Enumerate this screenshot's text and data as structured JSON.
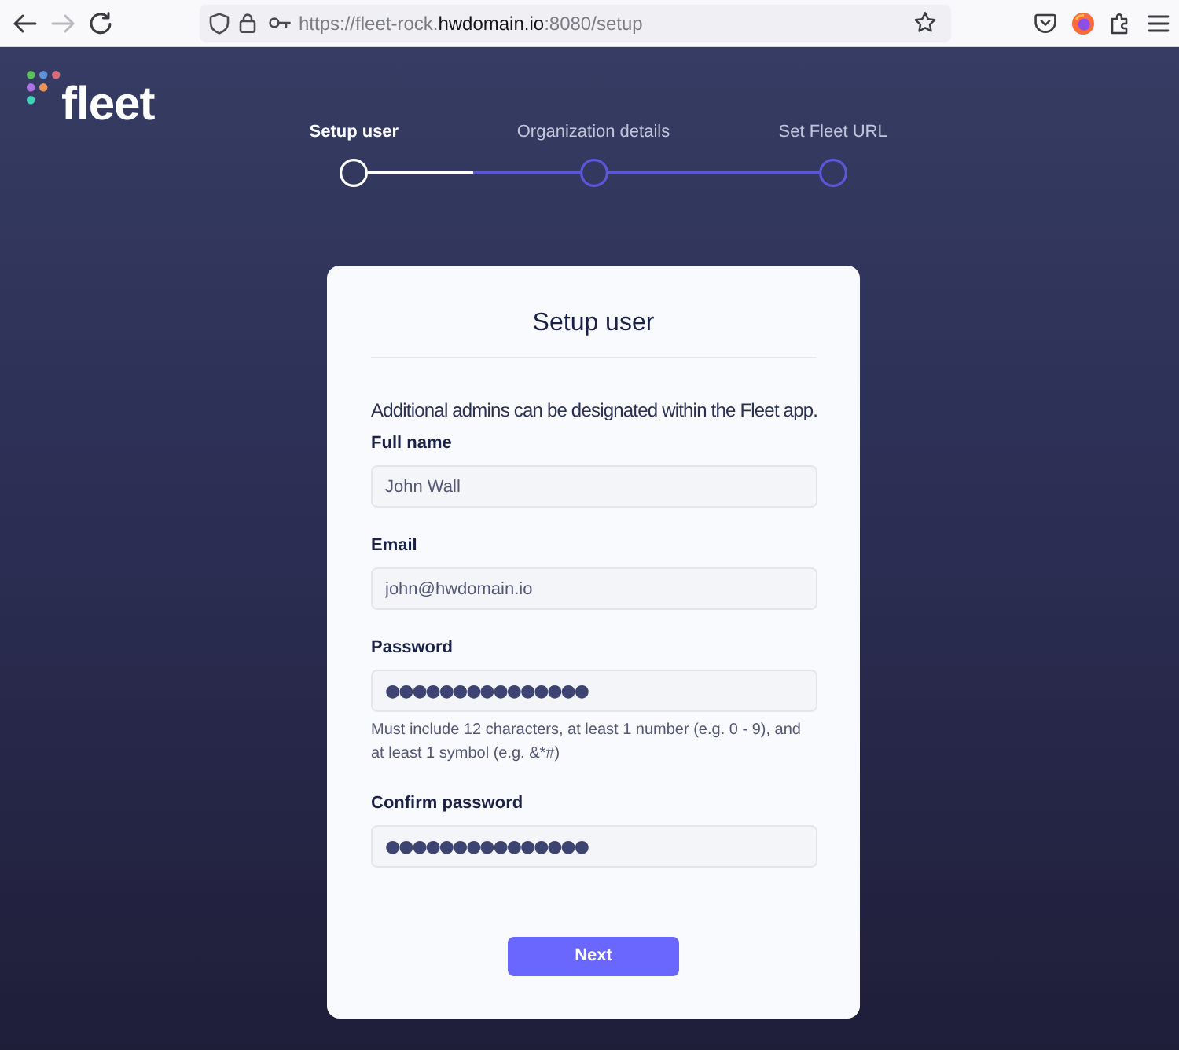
{
  "browser": {
    "nav_buttons": [
      {
        "kind": "back",
        "disabled": false
      },
      {
        "kind": "forward",
        "disabled": true
      },
      {
        "kind": "reload",
        "disabled": false
      }
    ],
    "url": [
      {
        "text": "https://fleet-rock.",
        "highlighted": false
      },
      {
        "text": "hwdomain.io",
        "highlighted": true
      },
      {
        "text": ":8080/setup",
        "highlighted": false
      }
    ]
  },
  "logo": {
    "text": "fleet"
  },
  "steps": [
    {
      "label": "Setup user",
      "selected": true
    },
    {
      "label": "Organization details",
      "selected": false
    },
    {
      "label": "Set Fleet URL",
      "selected": false
    }
  ],
  "card": {
    "title": "Setup user",
    "description": "Additional admins can be designated within the Fleet app.",
    "fields": [
      {
        "label": "Full name",
        "kind": "text",
        "value": "John Wall"
      },
      {
        "label": "Email",
        "kind": "text",
        "value": "john@hwdomain.io"
      },
      {
        "label": "Password",
        "kind": "password",
        "value": "●●●●●●●●●●●●●●●",
        "hint": "Must include 12 characters, at least 1 number (e.g. 0 - 9), and at least 1 symbol (e.g. &*#)"
      },
      {
        "label": "Confirm password",
        "kind": "password",
        "value": "●●●●●●●●●●●●●●●"
      }
    ],
    "button": "Next"
  }
}
